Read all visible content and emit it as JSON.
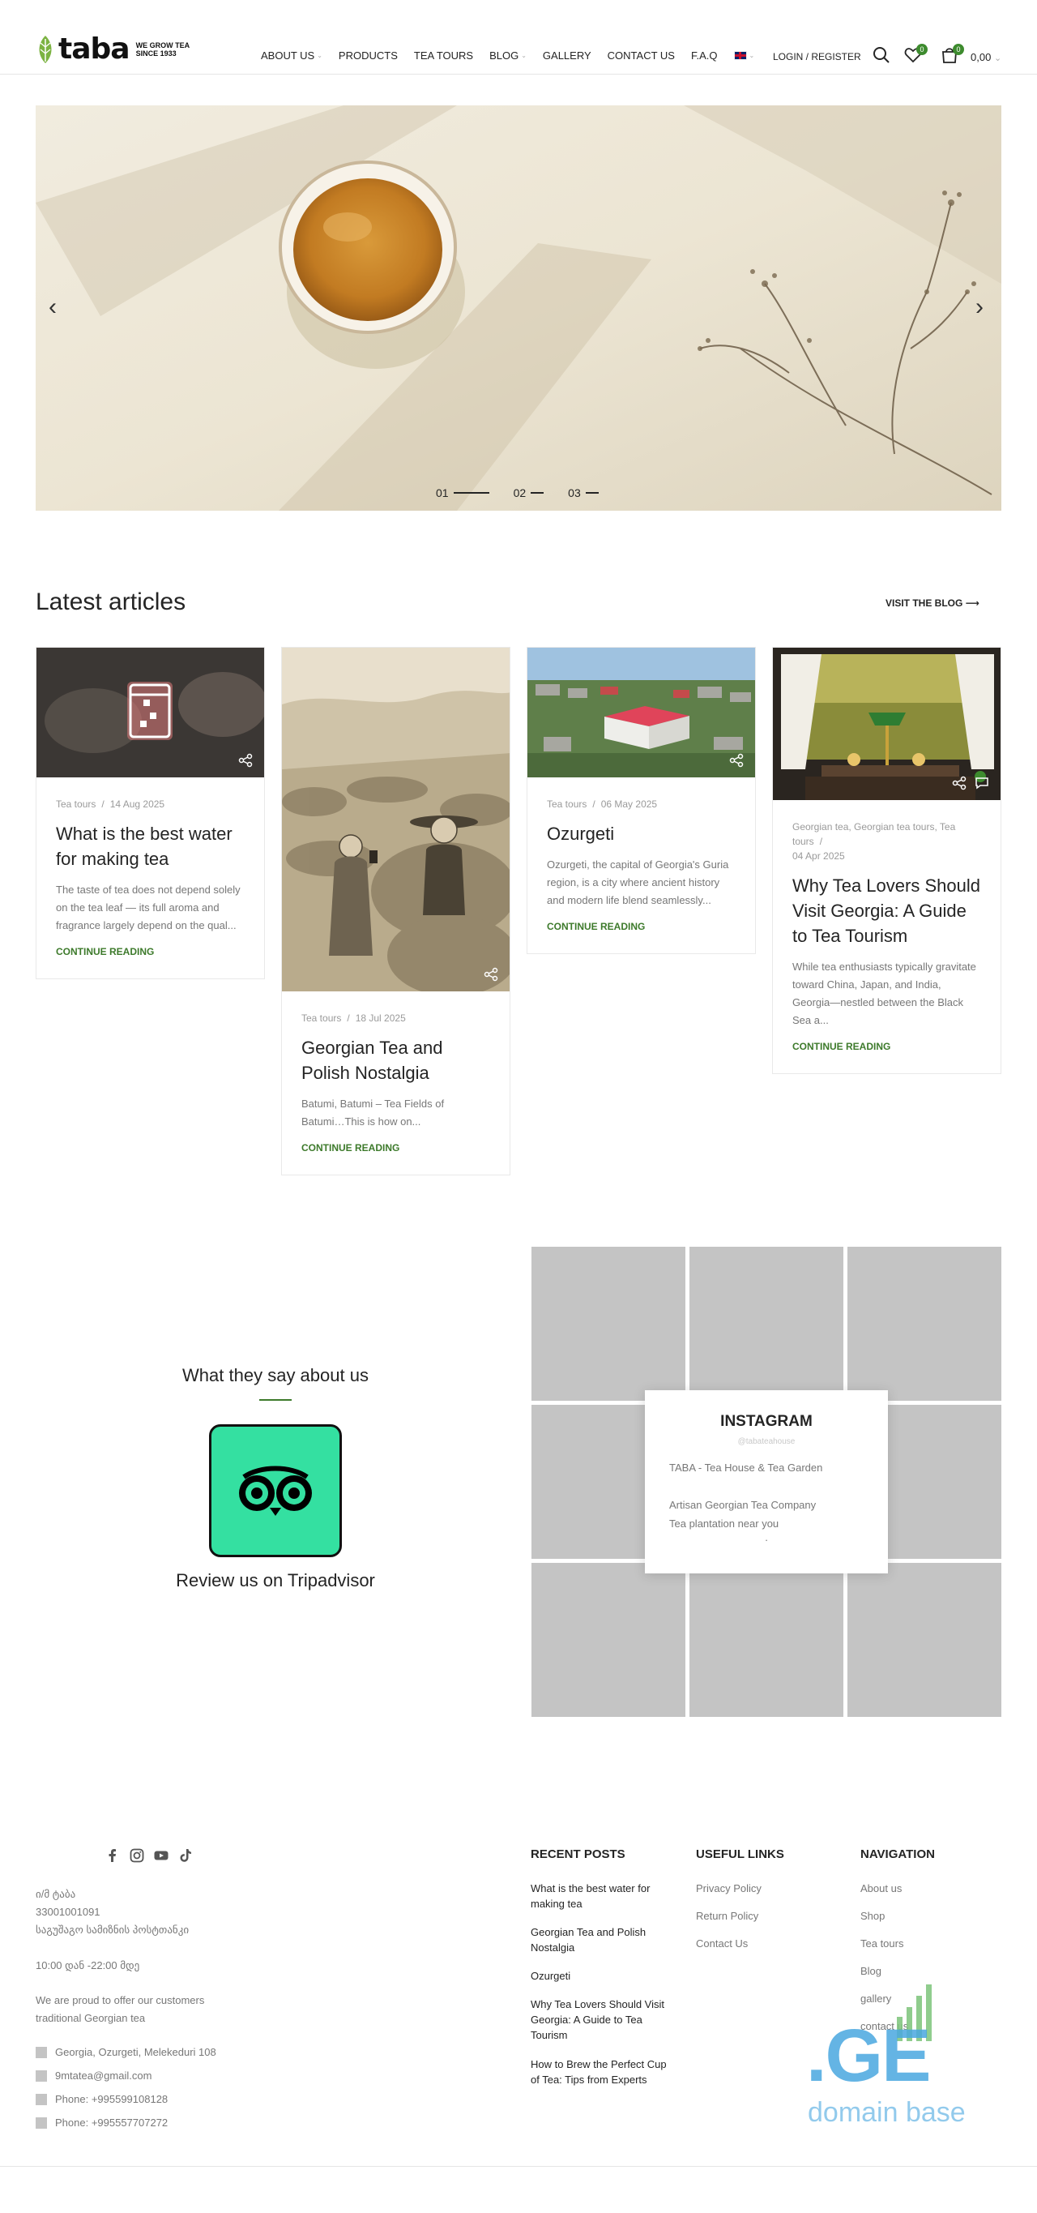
{
  "header": {
    "logo_word": "taba",
    "logo_tagline_1": "WE GROW TEA",
    "logo_tagline_2": "SINCE 1933",
    "nav": [
      {
        "label": "ABOUT US",
        "has_caret": true
      },
      {
        "label": "PRODUCTS",
        "has_caret": false
      },
      {
        "label": "TEA TOURS",
        "has_caret": false
      },
      {
        "label": "BLOG",
        "has_caret": true
      },
      {
        "label": "GALLERY",
        "has_caret": false
      },
      {
        "label": "CONTACT US",
        "has_caret": false
      },
      {
        "label": "F.A.Q",
        "has_caret": false
      }
    ],
    "language_icon": "uk-flag-icon",
    "login_label": "LOGIN / REGISTER",
    "wishlist_count": "0",
    "cart_count": "0",
    "cart_total": "0,00"
  },
  "hero": {
    "slides": [
      {
        "num": "01",
        "active": true
      },
      {
        "num": "02",
        "active": false
      },
      {
        "num": "03",
        "active": false
      }
    ],
    "prev_icon": "chevron-left-icon",
    "next_icon": "chevron-right-icon"
  },
  "articles": {
    "title": "Latest articles",
    "visit_blog": "VISIT THE BLOG",
    "continue_label": "CONTINUE READING",
    "items": [
      {
        "category": "Tea tours",
        "date": "14 Aug 2025",
        "title": "What is the best water for making tea",
        "excerpt": "The taste of tea does not depend solely on the tea leaf — its full aroma and fragrance largely depend on the qual..."
      },
      {
        "category": "Tea tours",
        "date": "18 Jul 2025",
        "title": "Georgian Tea and Polish Nostalgia",
        "excerpt": "Batumi, Batumi – Tea Fields of Batumi…This is how on..."
      },
      {
        "category": "Tea tours",
        "date": "06 May 2025",
        "title": "Ozurgeti",
        "excerpt": "Ozurgeti, the capital of Georgia's Guria region, is a city where ancient history and modern life blend seamlessly..."
      },
      {
        "category": "Georgian tea, Georgian tea tours, Tea tours",
        "date": "04 Apr 2025",
        "title": "Why Tea Lovers Should Visit Georgia: A Guide to Tea Tourism",
        "excerpt": "While tea enthusiasts typically gravitate toward China, Japan, and India, Georgia—nestled between the Black Sea a..."
      }
    ]
  },
  "testimonial": {
    "title": "What they say about us",
    "review_label": "Review us on Tripadvisor",
    "tripadvisor_icon": "tripadvisor-owl-icon",
    "tripadvisor_color": "#34e0a1"
  },
  "instagram": {
    "title": "INSTAGRAM",
    "handle": "@tabateahouse",
    "bio_line_1": "TABA - Tea House & Tea Garden",
    "bio_line_2": "Artisan Georgian Tea Company",
    "bio_line_3": "Tea plantation near you",
    "bio_dot": "."
  },
  "footer": {
    "social_icons": [
      "facebook-icon",
      "instagram-icon",
      "youtube-icon",
      "tiktok-icon"
    ],
    "company_1": "ი/მ ტაბა",
    "company_2": "33001001091",
    "company_3": "საგუშაგო სამიზნის პოსტთანკი",
    "hours": "10:00 დან -22:00 მდე",
    "about_1": "We are proud to offer our customers",
    "about_2": "traditional Georgian tea",
    "contacts": [
      "Georgia, Ozurgeti, Melekeduri 108",
      "9mtatea@gmail.com",
      "Phone: +995599108128",
      "Phone: +995557707272"
    ],
    "recent_posts_title": "RECENT POSTS",
    "recent_posts": [
      "What is the best water for making tea",
      "Georgian Tea and Polish Nostalgia",
      "Ozurgeti",
      "Why Tea Lovers Should Visit Georgia: A Guide to Tea Tourism",
      "How to Brew the Perfect Cup of Tea: Tips from Experts"
    ],
    "useful_title": "USEFUL LINKS",
    "useful_links": [
      "Privacy Policy",
      "Return Policy",
      "Contact Us"
    ],
    "navigation_title": "NAVIGATION",
    "navigation_links": [
      "About us",
      "Shop",
      "Tea tours",
      "Blog",
      "gallery",
      "contact us"
    ],
    "watermark_main": ".GE",
    "watermark_sub": "domain base"
  },
  "colors": {
    "accent_green": "#3d7a2b",
    "badge_green": "#3d8b2e",
    "watermark_blue": "#4aa8e0"
  }
}
